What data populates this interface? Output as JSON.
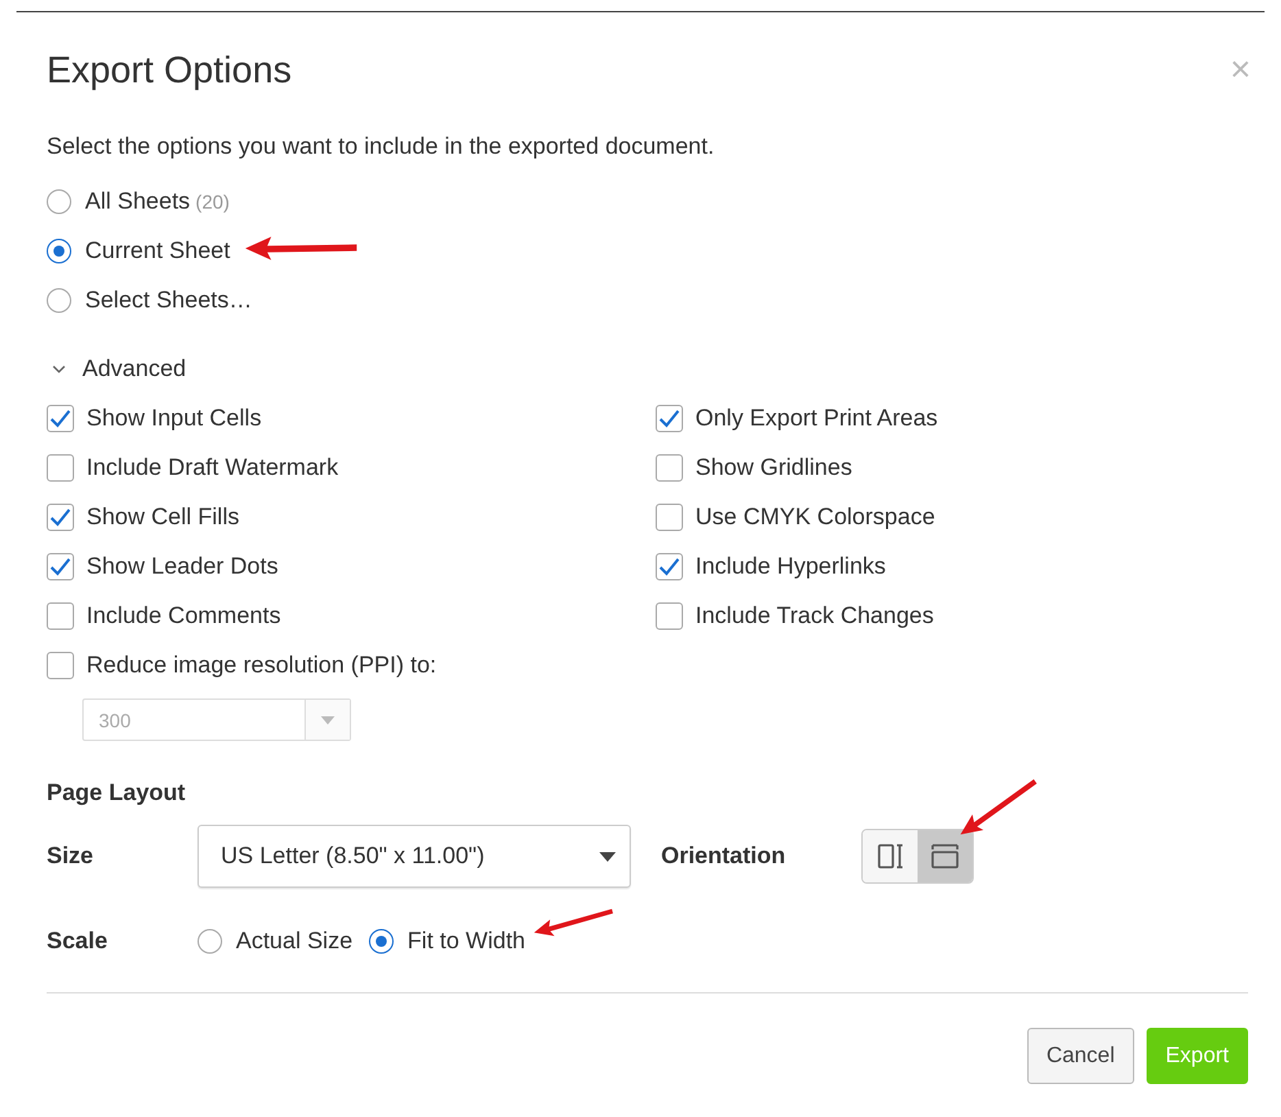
{
  "dialog": {
    "title": "Export Options",
    "close": "×",
    "intro": "Select the options you want to include in the exported document.",
    "sheets": [
      {
        "label": "All Sheets",
        "count": "(20)",
        "selected": false,
        "annotated": false
      },
      {
        "label": "Current Sheet",
        "selected": true,
        "annotated": true
      },
      {
        "label": "Select Sheets…",
        "selected": false,
        "annotated": false
      }
    ],
    "advanced": {
      "label": "Advanced",
      "expanded": true,
      "options": [
        {
          "label": "Show Input Cells",
          "checked": true
        },
        {
          "label": "Only Export Print Areas",
          "checked": true
        },
        {
          "label": "Include Draft Watermark",
          "checked": false
        },
        {
          "label": "Show Gridlines",
          "checked": false
        },
        {
          "label": "Show Cell Fills",
          "checked": true
        },
        {
          "label": "Use CMYK Colorspace",
          "checked": false
        },
        {
          "label": "Show Leader Dots",
          "checked": true
        },
        {
          "label": "Include Hyperlinks",
          "checked": true
        },
        {
          "label": "Include Comments",
          "checked": false
        },
        {
          "label": "Include Track Changes",
          "checked": false
        }
      ],
      "resolution": {
        "label": "Reduce image resolution (PPI) to:",
        "checked": false,
        "value": "300",
        "disabled": true
      }
    },
    "page_layout": {
      "heading": "Page Layout",
      "size_label": "Size",
      "size_value": "US Letter (8.50\" x 11.00\")",
      "orientation_label": "Orientation",
      "orientations": [
        {
          "kind": "portrait",
          "selected": false,
          "annotated": false
        },
        {
          "kind": "landscape",
          "selected": true,
          "annotated": true
        }
      ],
      "scale_label": "Scale",
      "scales": [
        {
          "label": "Actual Size",
          "selected": false,
          "annotated": false
        },
        {
          "label": "Fit to Width",
          "selected": true,
          "annotated": true
        }
      ]
    },
    "buttons": [
      {
        "label": "Cancel",
        "kind": "secondary"
      },
      {
        "label": "Export",
        "kind": "primary"
      }
    ]
  }
}
